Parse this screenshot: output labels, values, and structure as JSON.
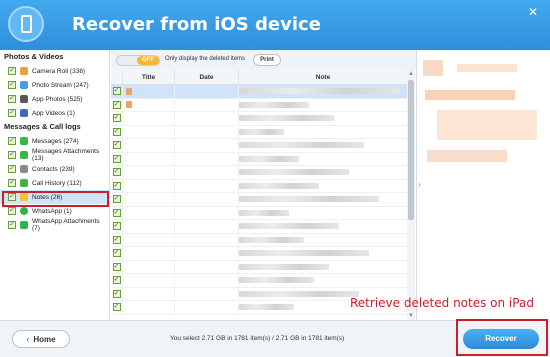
{
  "app": {
    "title": "Recover from iOS device",
    "close_glyph": "✕"
  },
  "sidebar": {
    "sections": [
      {
        "title": "Photos & Videos",
        "items": [
          {
            "label": "Camera Roll (336)",
            "icon_color": "#e8a13b"
          },
          {
            "label": "Photo Stream (247)",
            "icon_color": "#4a9be0"
          },
          {
            "label": "App Photos (525)",
            "icon_color": "#555555"
          },
          {
            "label": "App Videos (1)",
            "icon_color": "#3a6fb5"
          }
        ]
      },
      {
        "title": "Messages & Call logs",
        "items": [
          {
            "label": "Messages (274)",
            "icon_color": "#3bb54a"
          },
          {
            "label": "Messages Attachments (13)",
            "icon_color": "#3bb54a"
          },
          {
            "label": "Contacts (239)",
            "icon_color": "#8a8a8a"
          },
          {
            "label": "Call History (112)",
            "icon_color": "#3bb54a"
          },
          {
            "label": "Notes (26)",
            "icon_color": "#f2c23a"
          },
          {
            "label": "WhatsApp (1)",
            "icon_color": "#2fb34a"
          },
          {
            "label": "WhatsApp Attachments (7)",
            "icon_color": "#2fb34a"
          }
        ]
      }
    ]
  },
  "toolbar": {
    "toggle_label": "OFF",
    "only_deleted_label": "Only display the deleted items",
    "print_label": "Print"
  },
  "table": {
    "columns": [
      "Title",
      "Date",
      "Note"
    ],
    "row_count": 17
  },
  "footer": {
    "home_label": "Home",
    "status": "You select 2.71 GB in 1781 item(s) / 2.71 GB in 1781 item(s)",
    "recover_label": "Recover"
  },
  "annotation": "Retrieve deleted notes on iPad",
  "colors": {
    "header": "#2d8fda",
    "accent": "#f7b733",
    "highlight": "#c9212b"
  }
}
